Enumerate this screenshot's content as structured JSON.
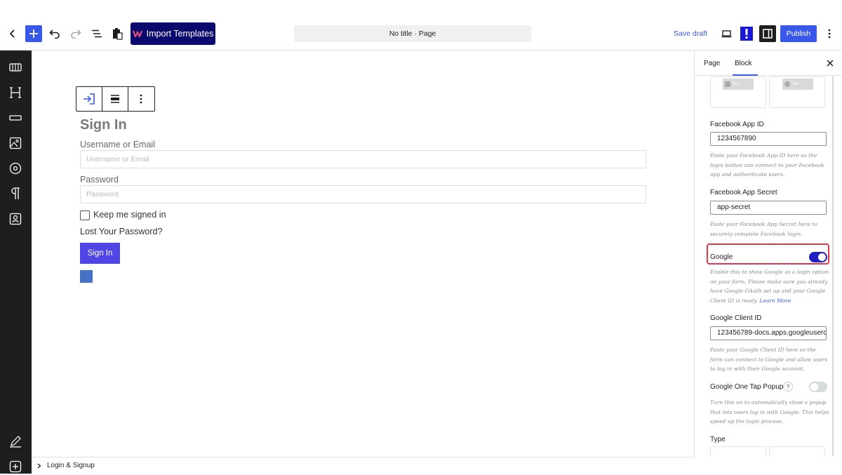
{
  "topbar": {
    "import_label": "Import Templates",
    "doc_title": "No title · Page",
    "save_draft": "Save draft",
    "publish": "Publish",
    "colors": {
      "accent": "#3858e9",
      "import_bg": "#0a0a6e"
    }
  },
  "sidebar": {
    "icons": [
      "layout-icon",
      "heading-icon",
      "divider-icon",
      "image-icon",
      "circle-icon",
      "paragraph-icon",
      "contact-card-icon"
    ],
    "bottom_icons": [
      "edit-icon",
      "add-block-icon"
    ]
  },
  "canvas": {
    "title": "Sign In",
    "username_label": "Username or Email",
    "username_placeholder": "Username or Email",
    "password_label": "Password",
    "password_placeholder": "Password",
    "keep_signed_in": "Keep me signed in",
    "lost_password": "Lost Your Password?",
    "signin_button": "Sign In"
  },
  "breadcrumb": {
    "label": "Login & Signup"
  },
  "panel": {
    "tabs": [
      "Page",
      "Block"
    ],
    "preset_text": "Text",
    "facebook_app_id_label": "Facebook App ID",
    "facebook_app_id_value": "1234567890",
    "facebook_app_id_help": "Paste your Facebook App ID here so the login button can connect to your Facebook app and authenticate users.",
    "facebook_secret_label": "Facebook App Secret",
    "facebook_secret_value": "app-secret",
    "facebook_secret_help": "Paste your Facebook App Secret here to securely complete Facebook login.",
    "google_label": "Google",
    "google_enabled": true,
    "google_help": "Enable this to show Google as a login option on your form. Please make sure you already have Google OAuth set up and your Google Client ID is ready.",
    "google_learn_more": "Learn More",
    "google_client_id_label": "Google Client ID",
    "google_client_id_value": "123456789-docs.apps.googleuserc",
    "google_client_id_help": "Paste your Google Client ID here so the form can connect to Google and allow users to log in with their Google account.",
    "one_tap_label": "Google One Tap Popup",
    "one_tap_help_icon": "?",
    "one_tap_enabled": false,
    "one_tap_help": "Turn this on to automatically show a popup that lets users log in with Google. This helps speed up the login process.",
    "type_label": "Type",
    "colors": {
      "toggle_on": "#1f1fbf",
      "toggle_off": "#d5dcdc",
      "highlight": "#e0374f"
    }
  }
}
